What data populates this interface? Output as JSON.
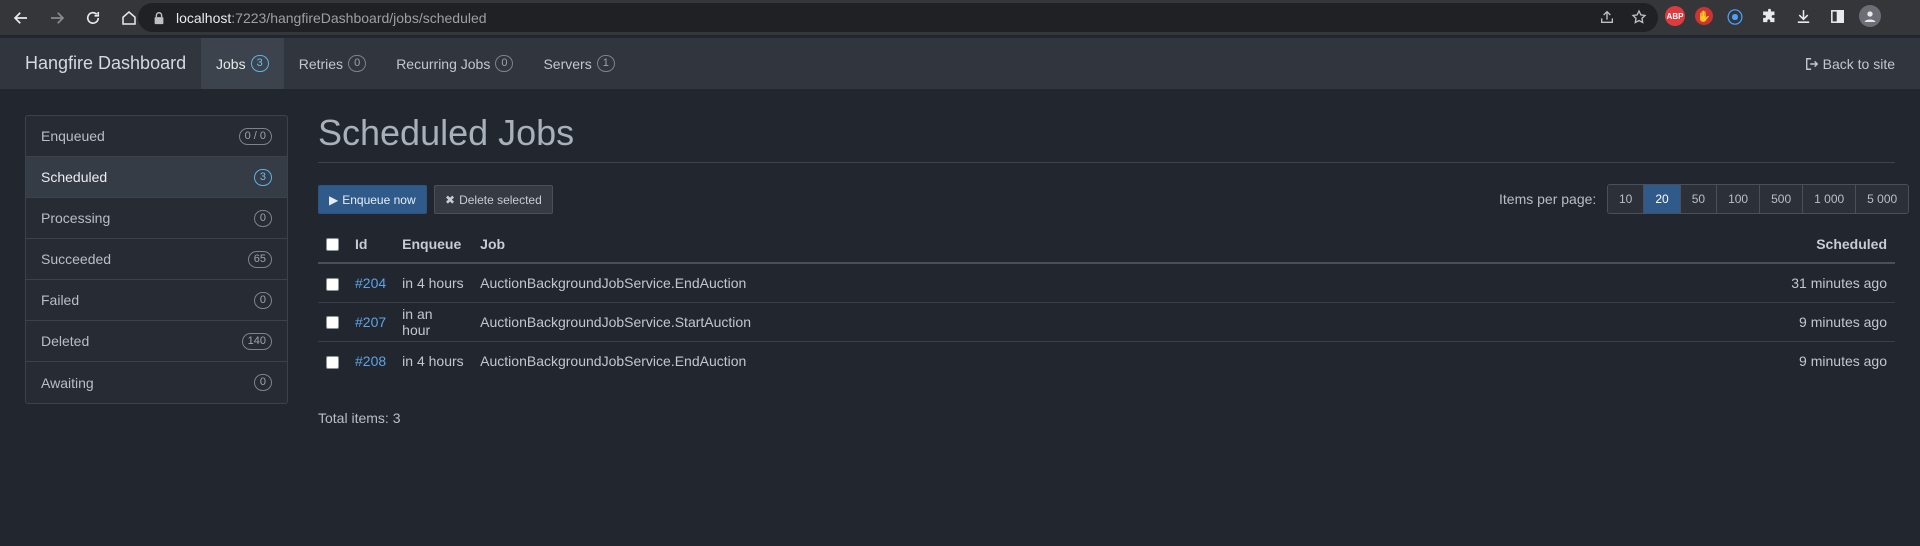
{
  "browser": {
    "url_host": "localhost",
    "url_rest": ":7223/hangfireDashboard/jobs/scheduled",
    "extensions": [
      {
        "icon": "adblock-icon",
        "label": "ABP"
      },
      {
        "icon": "hand-icon",
        "label": "✋"
      },
      {
        "icon": "wave-icon",
        "label": "⦿"
      },
      {
        "icon": "puzzle-icon",
        "label": ""
      },
      {
        "icon": "download-icon",
        "label": ""
      },
      {
        "icon": "sidepanel-icon",
        "label": ""
      },
      {
        "icon": "avatar-icon",
        "label": ""
      }
    ]
  },
  "navbar": {
    "brand": "Hangfire Dashboard",
    "links": [
      {
        "label": "Jobs",
        "count": "3",
        "active": true
      },
      {
        "label": "Retries",
        "count": "0",
        "active": false
      },
      {
        "label": "Recurring Jobs",
        "count": "0",
        "active": false
      },
      {
        "label": "Servers",
        "count": "1",
        "active": false
      }
    ],
    "back_label": "Back to site"
  },
  "sidebar": {
    "items": [
      {
        "label": "Enqueued",
        "count": "0 / 0"
      },
      {
        "label": "Scheduled",
        "count": "3"
      },
      {
        "label": "Processing",
        "count": "0"
      },
      {
        "label": "Succeeded",
        "count": "65"
      },
      {
        "label": "Failed",
        "count": "0"
      },
      {
        "label": "Deleted",
        "count": "140"
      },
      {
        "label": "Awaiting",
        "count": "0"
      }
    ]
  },
  "main": {
    "title": "Scheduled Jobs",
    "enqueue_label": "Enqueue now",
    "delete_label": "Delete selected",
    "items_per_page_label": "Items per page:",
    "page_sizes": [
      "10",
      "20",
      "50",
      "100",
      "500",
      "1 000",
      "5 000"
    ],
    "selected_page_size": "20",
    "columns": [
      "Id",
      "Enqueue",
      "Job",
      "Scheduled"
    ],
    "rows": [
      {
        "id": "#204",
        "enqueue": "in 4 hours",
        "job": "AuctionBackgroundJobService.EndAuction",
        "scheduled": "31 minutes ago"
      },
      {
        "id": "#207",
        "enqueue": "in an hour",
        "job": "AuctionBackgroundJobService.StartAuction",
        "scheduled": "9 minutes ago"
      },
      {
        "id": "#208",
        "enqueue": "in 4 hours",
        "job": "AuctionBackgroundJobService.EndAuction",
        "scheduled": "9 minutes ago"
      }
    ],
    "total_label": "Total items: 3"
  },
  "colors": {
    "page_bg": "#22262e",
    "navbar_bg": "#30353e",
    "primary": "#2f5a89",
    "link": "#5ea3e6"
  }
}
